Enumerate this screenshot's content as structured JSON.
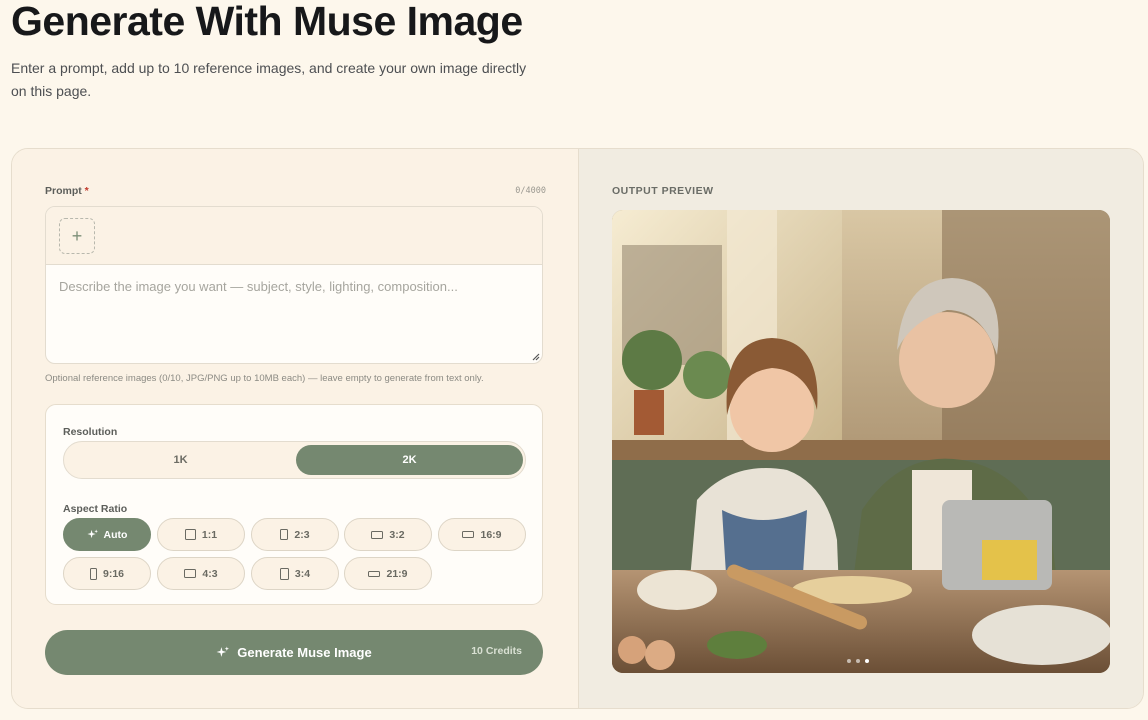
{
  "header": {
    "title": "Generate With Muse Image",
    "subtitle": "Enter a prompt, add up to 10 reference images, and create your own image directly on this page."
  },
  "prompt": {
    "label": "Prompt",
    "required_mark": "*",
    "char_count": "0/4000",
    "add_button_glyph": "+",
    "placeholder": "Describe the image you want — subject, style, lighting, composition...",
    "value": "",
    "help_text": "Optional reference images (0/10, JPG/PNG up to 10MB each) — leave empty to generate from text only."
  },
  "settings": {
    "resolution_label": "Resolution",
    "resolution_options": [
      "1K",
      "2K"
    ],
    "resolution_selected": "2K",
    "aspect_label": "Aspect Ratio",
    "aspect_options": [
      "Auto",
      "1:1",
      "2:3",
      "3:2",
      "16:9",
      "9:16",
      "4:3",
      "3:4",
      "21:9"
    ],
    "aspect_selected": "Auto"
  },
  "generate": {
    "label": "Generate Muse Image",
    "credits": "10 Credits"
  },
  "output": {
    "label": "OUTPUT PREVIEW",
    "slide_count": 3,
    "slide_active": 3
  },
  "colors": {
    "accent": "#758870",
    "background": "#fdf7ec",
    "panel": "#fbf2e5"
  },
  "icons": [
    "plus-icon",
    "sparkle-icon",
    "resize-handle-icon",
    "aspect-ratio-icon"
  ]
}
